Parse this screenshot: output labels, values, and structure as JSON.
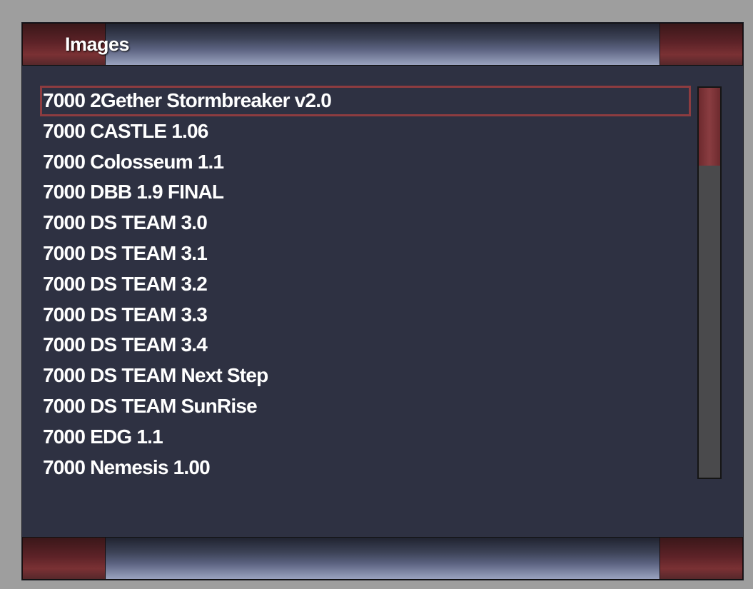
{
  "header": {
    "title": "Images"
  },
  "images_list": {
    "selected_index": 0,
    "items": [
      "7000 2Gether Stormbreaker v2.0",
      "7000 CASTLE 1.06",
      "7000 Colosseum 1.1",
      "7000 DBB 1.9 FINAL",
      "7000 DS TEAM 3.0",
      "7000 DS TEAM 3.1",
      "7000 DS TEAM 3.2",
      "7000 DS TEAM 3.3",
      "7000 DS TEAM 3.4",
      "7000 DS TEAM Next Step",
      "7000 DS TEAM SunRise",
      "7000 EDG 1.1",
      "7000 Nemesis 1.00"
    ]
  },
  "scrollbar": {
    "thumb_fraction": 0.2,
    "thumb_position": 0
  },
  "colors": {
    "background": "#2e3142",
    "accent": "#8d3c40",
    "text": "#ffffff"
  }
}
